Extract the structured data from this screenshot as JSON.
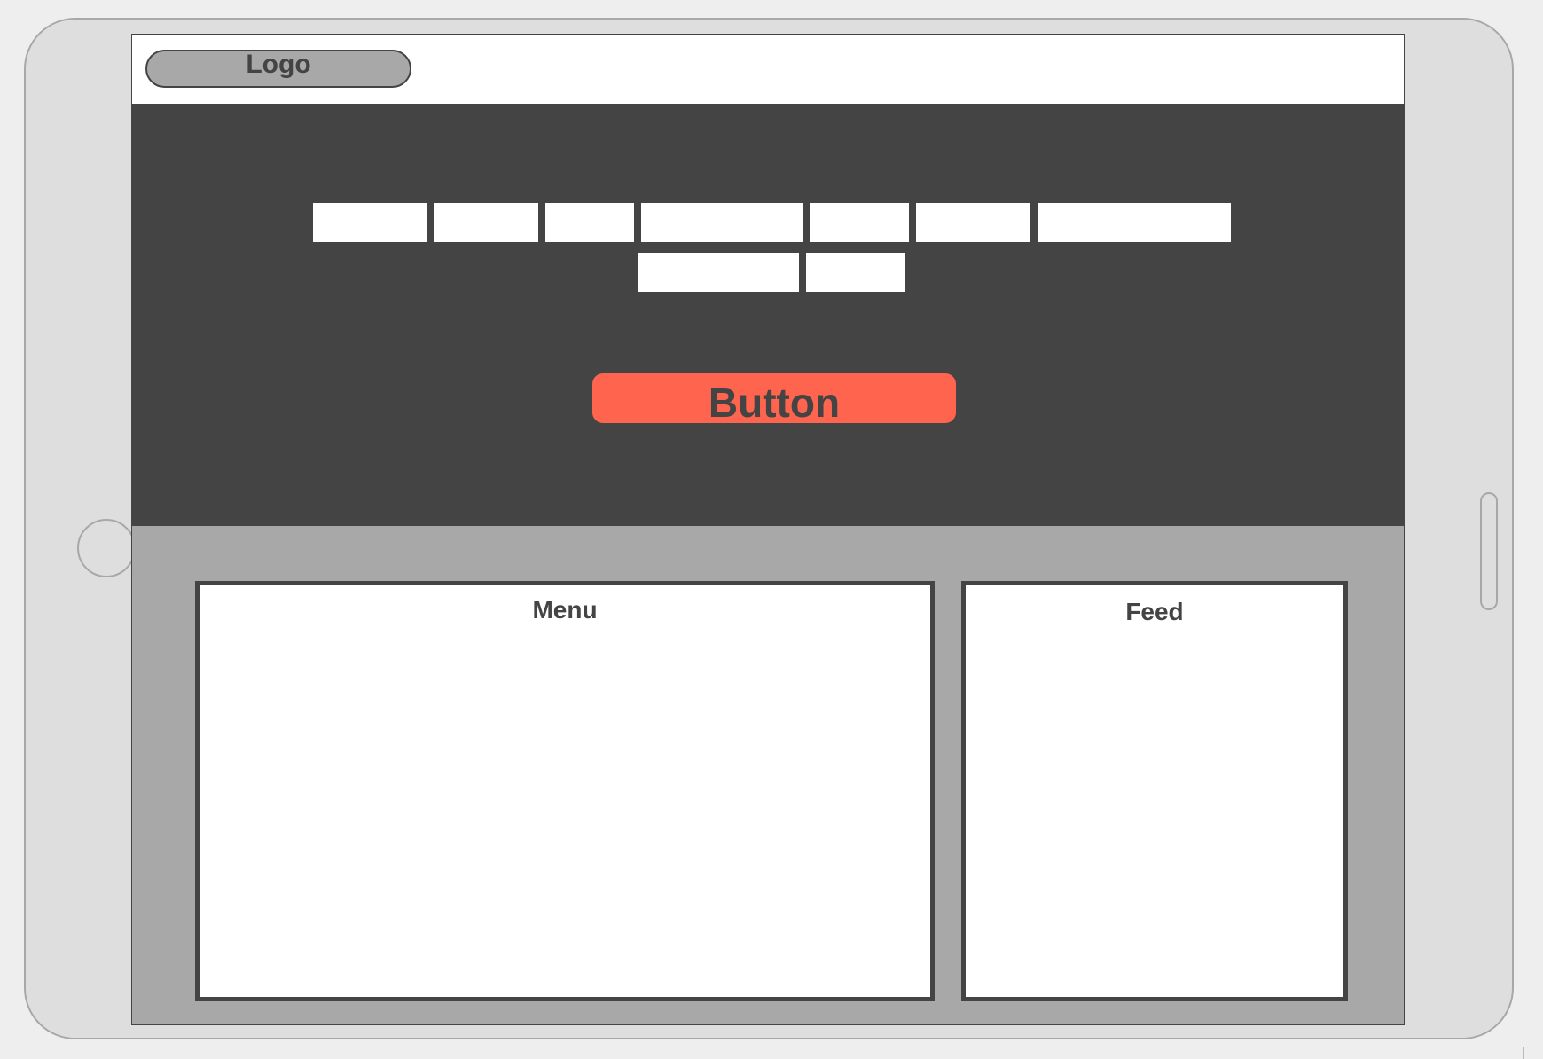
{
  "header": {
    "logo_label": "Logo"
  },
  "hero": {
    "nav_item_count": 9,
    "button_label": "Button"
  },
  "panels": {
    "menu_title": "Menu",
    "feed_title": "Feed"
  },
  "colors": {
    "frame": "#dedede",
    "hero_background": "#444444",
    "lower_background": "#a8a8a8",
    "button_accent": "#ff644e",
    "text": "#444444"
  }
}
